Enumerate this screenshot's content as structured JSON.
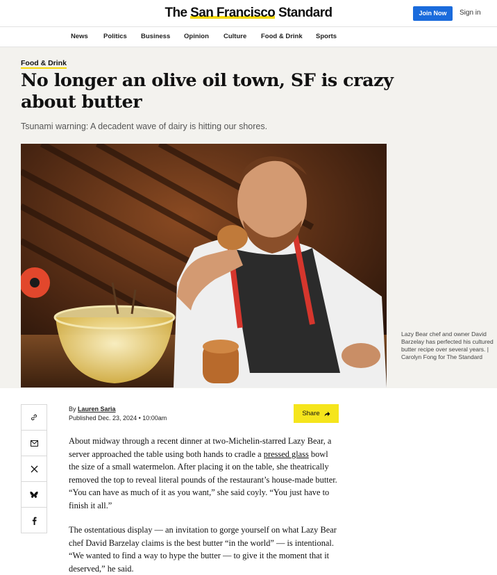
{
  "header": {
    "logo_prefix": "The ",
    "logo_highlight": "San Francisco",
    "logo_suffix": " Standard",
    "join_label": "Join Now",
    "signin_label": "Sign in"
  },
  "nav": {
    "items": [
      "News",
      "Politics",
      "Business",
      "Opinion",
      "Culture",
      "Food & Drink",
      "Sports"
    ]
  },
  "article": {
    "category": "Food & Drink",
    "headline": "No longer an olive oil town, SF is crazy about butter",
    "dek": "Tsunami warning: A decadent wave of dairy is hitting our shores.",
    "caption": "Lazy Bear chef and owner David Barzelay has perfected his cultured butter recipe over several years. | Carolyn Fong for The Standard",
    "byline_prefix": "By ",
    "author": "Lauren Saria",
    "published": "Published Dec. 23, 2024 • 10:00am",
    "share_label": "Share",
    "para1_a": "About midway through a recent dinner at two-Michelin-starred Lazy Bear, a server approached the table using both hands to cradle a ",
    "para1_link": "pressed glass",
    "para1_b": " bowl the size of a small watermelon. After placing it on the table, she theatrically removed the top to reveal literal pounds of the restaurant’s house-made butter. “You can have as much of it as you want,” she said coyly. “You just have to finish it all.”",
    "para2": "The ostentatious display — an invitation to gorge yourself on what Lazy Bear chef David Barzelay claims is the best butter “in the world” — is intentional. “We wanted to find a way to hype the butter — to give it the moment that it deserved,” he said."
  },
  "share_rail": {
    "icons": [
      "link-icon",
      "email-icon",
      "x-icon",
      "bluesky-icon",
      "facebook-icon"
    ]
  }
}
